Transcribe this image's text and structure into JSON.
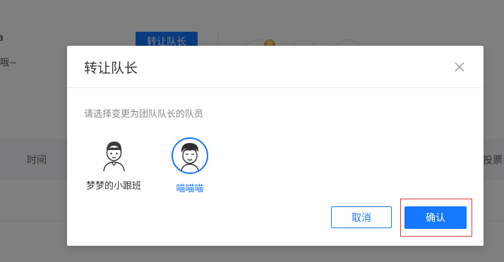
{
  "background": {
    "title_fragment": "a",
    "subtitle_fragment": "哦~",
    "transfer_button_label": "转让队长",
    "avatar_badge": "我",
    "table_header": {
      "time": "时间",
      "vote": "投票"
    }
  },
  "dialog": {
    "title": "转让队长",
    "instruction": "请选择变更为团队队长的队员",
    "members": [
      {
        "name": "梦梦的小跟班",
        "selected": false
      },
      {
        "name": "喵喵喵",
        "selected": true
      }
    ],
    "cancel_label": "取消",
    "confirm_label": "确认"
  },
  "colors": {
    "primary": "#1677ff",
    "highlight_border": "#e03a3a",
    "overlay": "rgba(0,0,0,0.5)"
  }
}
